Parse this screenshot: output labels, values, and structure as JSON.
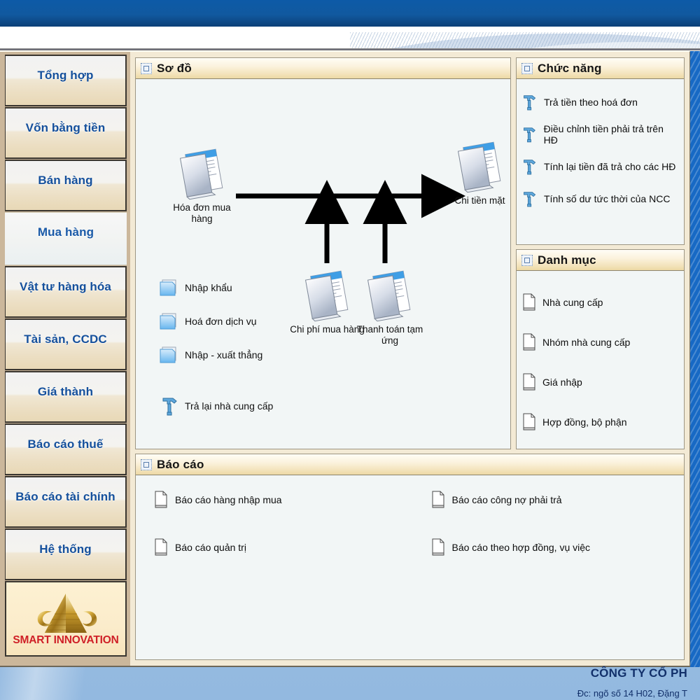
{
  "window": {
    "titlebar_color": "#0d5aa7",
    "desktop_color": "#9cc0e4"
  },
  "sidebar": {
    "logo": {
      "text": "SMART INNOVATION",
      "color": "#cf2027",
      "icon": "pyramid-sas-logo"
    },
    "items": [
      {
        "label": "Tổng hợp",
        "active": false
      },
      {
        "label": "Vốn bằng tiền",
        "active": false
      },
      {
        "label": "Bán hàng",
        "active": false
      },
      {
        "label": "Mua hàng",
        "active": true
      },
      {
        "label": "Vật tư hàng hóa",
        "active": false
      },
      {
        "label": "Tài sản, CCDC",
        "active": false
      },
      {
        "label": "Giá thành",
        "active": false
      },
      {
        "label": "Báo cáo thuế",
        "active": false
      },
      {
        "label": "Báo cáo tài chính",
        "active": false
      },
      {
        "label": "Hệ thống",
        "active": false
      }
    ]
  },
  "diagram_panel": {
    "title": "Sơ đồ",
    "icon": "diagram-icon",
    "nodes": [
      {
        "id": "hoa-don-mua-hang",
        "label": "Hóa đơn mua\nhàng",
        "icon": "documents-icon"
      },
      {
        "id": "chi-tien-mat",
        "label": "Chi tiền mặt",
        "icon": "documents-icon"
      },
      {
        "id": "chi-phi-mua-hang",
        "label": "Chi phí mua hàng",
        "icon": "documents-icon"
      },
      {
        "id": "thanh-toan-tam-ung",
        "label": "Thanh toán  tạm\nứng",
        "icon": "documents-icon"
      }
    ],
    "arrows": [
      {
        "from": "hoa-don-mua-hang",
        "to": "chi-tien-mat",
        "direction": "right"
      },
      {
        "from": "chi-phi-mua-hang",
        "to": "flow-line",
        "direction": "up"
      },
      {
        "from": "thanh-toan-tam-ung",
        "to": "flow-line",
        "direction": "up"
      }
    ],
    "shortcuts": [
      {
        "label": "Nhập khẩu",
        "icon": "folder-icon"
      },
      {
        "label": "Hoá đơn dịch vụ",
        "icon": "folder-icon"
      },
      {
        "label": "Nhập - xuất thẳng",
        "icon": "folder-icon"
      },
      {
        "label": "Trả lại nhà cung cấp",
        "icon": "hammer-icon"
      }
    ]
  },
  "functions_panel": {
    "title": "Chức năng",
    "icon": "functions-icon",
    "items": [
      {
        "label": "Trả  tiền theo hoá đơn",
        "icon": "hammer-icon"
      },
      {
        "label": "Điều chỉnh tiền phải trả trên HĐ",
        "icon": "hammer-icon"
      },
      {
        "label": "Tính lại tiền đã trả cho các HĐ",
        "icon": "hammer-icon"
      },
      {
        "label": "Tính số dư tức thời của NCC",
        "icon": "hammer-icon"
      }
    ]
  },
  "catalog_panel": {
    "title": "Danh mục",
    "icon": "catalog-icon",
    "items": [
      {
        "label": "Nhà cung cấp",
        "icon": "page-icon"
      },
      {
        "label": "Nhóm nhà cung cấp",
        "icon": "page-icon"
      },
      {
        "label": "Giá nhập",
        "icon": "page-icon"
      },
      {
        "label": "Hợp đồng, bộ phận",
        "icon": "page-icon"
      }
    ]
  },
  "reports_panel": {
    "title": "Báo cáo",
    "icon": "reports-icon",
    "items": [
      {
        "label": "Báo cáo hàng nhập mua",
        "icon": "page-icon"
      },
      {
        "label": "Báo cáo công nợ phải trả",
        "icon": "page-icon"
      },
      {
        "label": "Báo cáo quản trị",
        "icon": "page-icon"
      },
      {
        "label": "Báo cáo theo hợp đồng, vụ việc",
        "icon": "page-icon"
      }
    ]
  },
  "footer": {
    "company": "CÔNG TY CỔ PH",
    "address": "Đc: ngõ số 14 H02, Đặng T"
  }
}
